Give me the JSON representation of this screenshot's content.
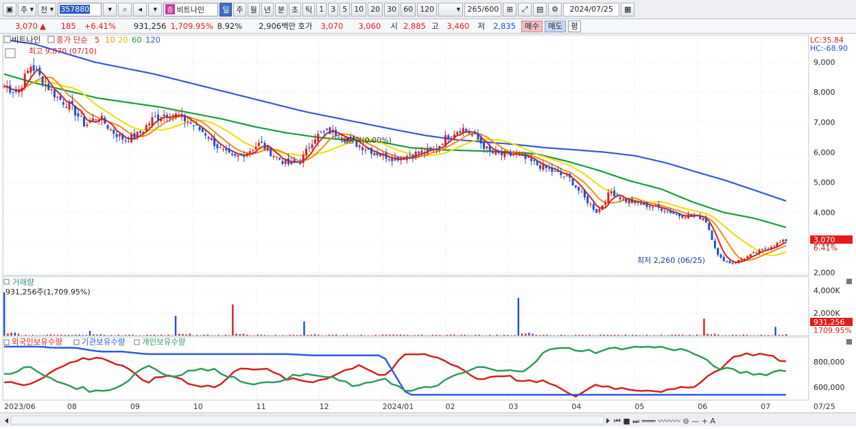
{
  "toolbar": {
    "market": "주",
    "scope": "전",
    "code": "357880",
    "stock_name": "비트나인",
    "stock_badge": "증",
    "periods": [
      "일",
      "주",
      "월",
      "년",
      "분",
      "초",
      "틱"
    ],
    "active_period": "일",
    "minute_options": [
      "1",
      "3",
      "5",
      "10",
      "20",
      "30",
      "60",
      "120"
    ],
    "count": "265",
    "count_total": "/600",
    "date": "2024/07/25"
  },
  "quote": {
    "price": "3,070",
    "arrow": "▲",
    "change": "185",
    "change_pct": "+6.41%",
    "volume": "931,256",
    "volume_pct": "1,709.95%",
    "turnover": "8.92%",
    "amount": "2,906백만",
    "hoga_label": "호가",
    "ask": "3,070",
    "bid": "3,060",
    "open_label": "시",
    "open": "2,885",
    "high_label": "고",
    "high": "3,460",
    "low_label": "저",
    "low": "2,835",
    "buy": "매수",
    "sell": "매도",
    "flat": "평"
  },
  "price_panel": {
    "legend_name": "비트나인",
    "legend_ma": "종가 단순",
    "ma_periods": [
      {
        "label": "5",
        "color": "#d42020"
      },
      {
        "label": "10",
        "color": "#f08c10"
      },
      {
        "label": "20",
        "color": "#f2dc00"
      },
      {
        "label": "60",
        "color": "#1c9a3c"
      },
      {
        "label": "120",
        "color": "#3358d8"
      }
    ],
    "lc": "LC:35.84",
    "hc": "HC:-68.90",
    "high_note": "최고 9,870 (07/10)",
    "low_note": "최저 2,260 (06/25)",
    "dividend_note": "배당락(0.00%)",
    "last_price_tag": "3,070",
    "last_pct_tag": "6.41%",
    "y_ticks": [
      "9,000",
      "8,000",
      "7,000",
      "6,000",
      "5,000",
      "4,000",
      "3,000",
      "2,000"
    ]
  },
  "volume_panel": {
    "title": "거래량",
    "value": "931,256주(1,709.95%)",
    "y_ticks": [
      "4,000K",
      "2,000K"
    ],
    "last_tag": "931,256",
    "last_pct_tag": "1709.95%"
  },
  "holdings_panel": {
    "labels": [
      "외국인보유수량",
      "기관보유수량",
      "개인보유수량"
    ],
    "y_ticks": [
      "800,000",
      "600,000"
    ]
  },
  "x_axis": [
    "2023/06",
    "08",
    "09",
    "10",
    "11",
    "12",
    "2024/01",
    "02",
    "03",
    "04",
    "05",
    "06",
    "07",
    "07/25"
  ],
  "colors": {
    "up": "#d42020",
    "down": "#1a4fd6",
    "foreign": "#d42020",
    "institution": "#2b5be0",
    "individual": "#2e9a5a"
  },
  "chart_data": {
    "type": "candlestick",
    "title": "비트나인",
    "x": [
      "2023/06",
      "08",
      "09",
      "10",
      "11",
      "12",
      "2024/01",
      "02",
      "03",
      "04",
      "05",
      "06",
      "07",
      "07/25"
    ],
    "ohlc_last": {
      "open": 2885,
      "high": 3460,
      "low": 2835,
      "close": 3070
    },
    "ylim": [
      2000,
      9900
    ],
    "price_closes": [
      8200,
      8000,
      8900,
      8300,
      7800,
      7500,
      6900,
      7200,
      6700,
      6400,
      6600,
      7100,
      7300,
      7200,
      6900,
      6600,
      6100,
      5800,
      6000,
      6300,
      5900,
      5600,
      5700,
      6500,
      6700,
      6600,
      6300,
      6100,
      5900,
      5800,
      5900,
      6000,
      6100,
      6600,
      6800,
      6500,
      6000,
      5900,
      5900,
      5700,
      5500,
      5300,
      5100,
      4500,
      4000,
      4700,
      4400,
      4300,
      4200,
      4100,
      3900,
      3900,
      3800,
      2500,
      2300,
      2500,
      2700,
      2900,
      3070
    ],
    "ma120": [
      9750,
      9600,
      9300,
      9000,
      8800,
      8600,
      8350,
      8100,
      7850,
      7600,
      7350,
      7150,
      6950,
      6750,
      6560,
      6420,
      6340,
      6260,
      6150,
      6080,
      6000,
      5880,
      5650,
      5350,
      5060,
      4720,
      4380
    ],
    "ma60": [
      8600,
      8300,
      8050,
      7800,
      7650,
      7500,
      7300,
      7100,
      6850,
      6650,
      6500,
      6400,
      6350,
      6150,
      6080,
      6050,
      6020,
      5950,
      5700,
      5400,
      5050,
      4780,
      4350,
      4000,
      3800,
      3500
    ],
    "volume_k": [
      4600,
      200,
      100,
      100,
      100,
      100,
      500,
      100,
      100,
      100,
      100,
      100,
      2100,
      200,
      100,
      100,
      3300,
      100,
      100,
      100,
      100,
      1500,
      100,
      100,
      100,
      100,
      100,
      100,
      100,
      100,
      100,
      100,
      100,
      100,
      100,
      100,
      4000,
      200,
      100,
      100,
      100,
      100,
      100,
      100,
      100,
      100,
      100,
      100,
      100,
      1800,
      100,
      100,
      100,
      100,
      931
    ],
    "series": [
      {
        "name": "외국인보유수량",
        "values": [
          640,
          620,
          720,
          810,
          840,
          760,
          640,
          700,
          620,
          600,
          760,
          740,
          660,
          640,
          700,
          780,
          680,
          860,
          850,
          780,
          660,
          700,
          640,
          640,
          520,
          620,
          590,
          580,
          570,
          600,
          720,
          860,
          860,
          800
        ]
      },
      {
        "name": "기관보유수량",
        "values": [
          930,
          930,
          910,
          910,
          880,
          880,
          860,
          860,
          860,
          860,
          860,
          860,
          860,
          850,
          850,
          850,
          850,
          540,
          540,
          540,
          540,
          540,
          540,
          540,
          540,
          540,
          540,
          540,
          540,
          540,
          540,
          540,
          540,
          540
        ]
      },
      {
        "name": "개인보유수량",
        "values": [
          700,
          760,
          660,
          600,
          560,
          620,
          780,
          680,
          740,
          730,
          650,
          620,
          680,
          700,
          660,
          600,
          680,
          560,
          600,
          680,
          760,
          720,
          740,
          900,
          900,
          880,
          910,
          920,
          910,
          880,
          760,
          720,
          700,
          740
        ]
      }
    ]
  }
}
